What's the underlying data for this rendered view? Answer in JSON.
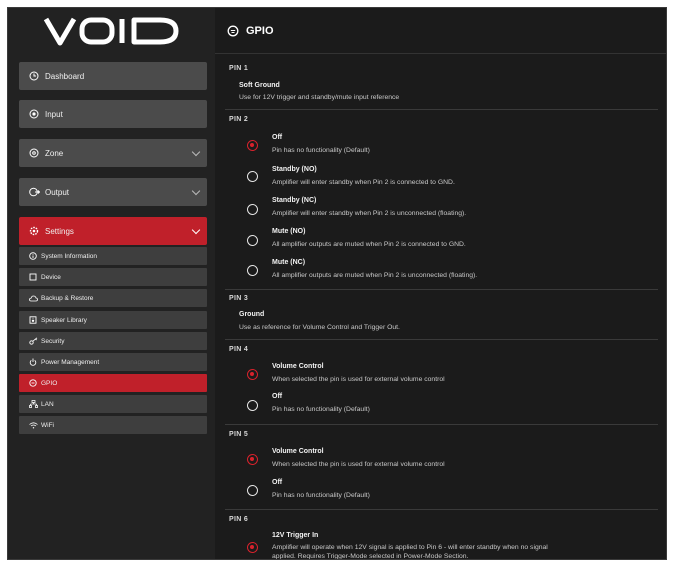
{
  "brand": {
    "logo_text": "VOID"
  },
  "colors": {
    "accent": "#c0202a",
    "sidebar_bg": "#222222",
    "panel_bg": "#1b1b1b"
  },
  "sidebar": {
    "items": [
      {
        "label": "Dashboard",
        "icon": "clock-icon"
      },
      {
        "label": "Input",
        "icon": "target-icon"
      },
      {
        "label": "Zone",
        "icon": "disc-icon"
      },
      {
        "label": "Output",
        "icon": "output-icon"
      },
      {
        "label": "Settings",
        "icon": "gear-icon"
      }
    ],
    "settings_sub": [
      {
        "label": "System Information",
        "icon": "info-icon"
      },
      {
        "label": "Device",
        "icon": "device-icon"
      },
      {
        "label": "Backup & Restore",
        "icon": "cloud-icon"
      },
      {
        "label": "Speaker Library",
        "icon": "speaker-icon"
      },
      {
        "label": "Security",
        "icon": "key-icon"
      },
      {
        "label": "Power Management",
        "icon": "power-icon"
      },
      {
        "label": "GPIO",
        "icon": "gpio-icon"
      },
      {
        "label": "LAN",
        "icon": "lan-icon"
      },
      {
        "label": "WiFi",
        "icon": "wifi-icon"
      }
    ]
  },
  "header": {
    "title": "GPIO"
  },
  "pins": {
    "pin1": {
      "label": "PIN 1",
      "title": "Soft Ground",
      "desc": "Use for 12V trigger and standby/mute input reference"
    },
    "pin2": {
      "label": "PIN 2",
      "options": [
        {
          "title": "Off",
          "desc": "Pin has no functionality (Default)",
          "selected": true
        },
        {
          "title": "Standby (NO)",
          "desc": "Amplifier will enter standby when Pin 2 is connected to GND.",
          "selected": false
        },
        {
          "title": "Standby (NC)",
          "desc": "Amplifier will enter standby when Pin 2 is unconnected (floating).",
          "selected": false
        },
        {
          "title": "Mute (NO)",
          "desc": "All amplifier outputs are muted when Pin 2 is connected to GND.",
          "selected": false
        },
        {
          "title": "Mute (NC)",
          "desc": "All amplifier outputs are muted when Pin 2 is unconnected (floating).",
          "selected": false
        }
      ]
    },
    "pin3": {
      "label": "PIN 3",
      "title": "Ground",
      "desc": "Use as reference for Volume Control and Trigger Out."
    },
    "pin4": {
      "label": "PIN 4",
      "options": [
        {
          "title": "Volume Control",
          "desc": "When selected the pin is used for external volume control",
          "selected": true
        },
        {
          "title": "Off",
          "desc": "Pin has no functionality (Default)",
          "selected": false
        }
      ]
    },
    "pin5": {
      "label": "PIN 5",
      "options": [
        {
          "title": "Volume Control",
          "desc": "When selected the pin is used for external volume control",
          "selected": true
        },
        {
          "title": "Off",
          "desc": "Pin has no functionality (Default)",
          "selected": false
        }
      ]
    },
    "pin6": {
      "label": "PIN 6",
      "options": [
        {
          "title": "12V Trigger In",
          "desc": "Amplifier will operate when 12V signal is applied to Pin 6 - will enter standby when no signal",
          "desc2": "applied. Requires Trigger-Mode selected in Power-Mode Section.",
          "selected": true
        }
      ]
    }
  }
}
